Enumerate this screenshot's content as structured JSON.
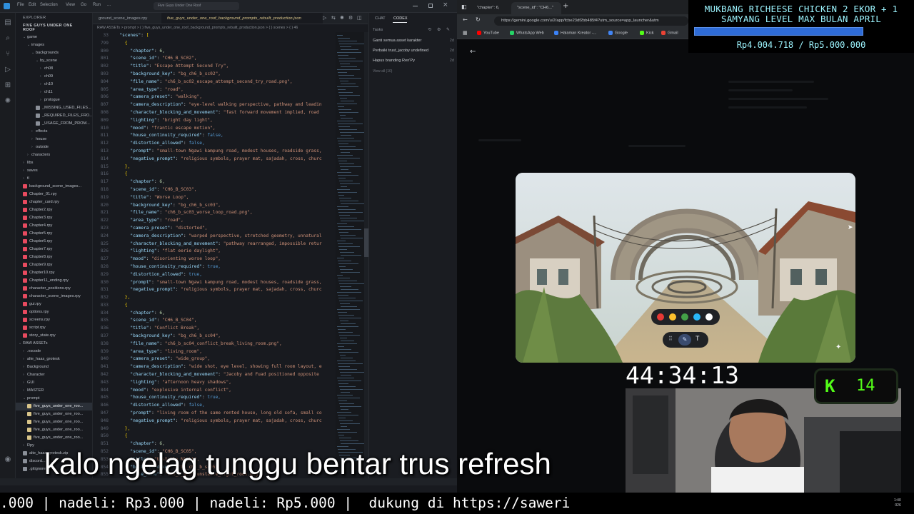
{
  "vscode": {
    "title": "Five Guys Under One Roof",
    "menu": [
      "File",
      "Edit",
      "Selection",
      "View",
      "Go",
      "Run",
      "..."
    ],
    "explorer_header": "EXPLORER",
    "project_name": "FIVE GUYS UNDER ONE ROOF",
    "tree": [
      {
        "label": "game",
        "indent": 1,
        "kind": "folder-open"
      },
      {
        "label": "images",
        "indent": 2,
        "kind": "folder-open"
      },
      {
        "label": "backgrounds",
        "indent": 3,
        "kind": "folder-open"
      },
      {
        "label": "by_scene",
        "indent": 4,
        "kind": "folder-open"
      },
      {
        "label": "ch08",
        "indent": 5,
        "kind": "folder"
      },
      {
        "label": "ch09",
        "indent": 5,
        "kind": "folder"
      },
      {
        "label": "ch10",
        "indent": 5,
        "kind": "folder"
      },
      {
        "label": "ch11",
        "indent": 5,
        "kind": "folder"
      },
      {
        "label": "prologue",
        "indent": 5,
        "kind": "folder"
      },
      {
        "label": "_MISSING_USED_FILES...",
        "indent": 4,
        "kind": "file"
      },
      {
        "label": "_REQUIRED_FILES_FRO...",
        "indent": 4,
        "kind": "file"
      },
      {
        "label": "_USAGE_FROM_PROM...",
        "indent": 4,
        "kind": "file"
      },
      {
        "label": "effects",
        "indent": 3,
        "kind": "folder"
      },
      {
        "label": "house",
        "indent": 3,
        "kind": "folder"
      },
      {
        "label": "outside",
        "indent": 3,
        "kind": "folder"
      },
      {
        "label": "characters",
        "indent": 2,
        "kind": "folder"
      },
      {
        "label": "libs",
        "indent": 1,
        "kind": "folder"
      },
      {
        "label": "saves",
        "indent": 1,
        "kind": "folder"
      },
      {
        "label": "tl",
        "indent": 1,
        "kind": "folder"
      },
      {
        "label": "background_scene_images...",
        "indent": 1,
        "kind": "rpy"
      },
      {
        "label": "Chapter_01.rpy",
        "indent": 1,
        "kind": "rpy"
      },
      {
        "label": "chapter_card.rpy",
        "indent": 1,
        "kind": "rpy"
      },
      {
        "label": "Chapter2.rpy",
        "indent": 1,
        "kind": "rpy"
      },
      {
        "label": "Chapter3.rpy",
        "indent": 1,
        "kind": "rpy"
      },
      {
        "label": "Chapter4.rpy",
        "indent": 1,
        "kind": "rpy"
      },
      {
        "label": "Chapter5.rpy",
        "indent": 1,
        "kind": "rpy"
      },
      {
        "label": "Chapter6.rpy",
        "indent": 1,
        "kind": "rpy"
      },
      {
        "label": "Chapter7.rpy",
        "indent": 1,
        "kind": "rpy"
      },
      {
        "label": "Chapter8.rpy",
        "indent": 1,
        "kind": "rpy"
      },
      {
        "label": "Chapter9.rpy",
        "indent": 1,
        "kind": "rpy"
      },
      {
        "label": "Chapter10.rpy",
        "indent": 1,
        "kind": "rpy"
      },
      {
        "label": "Chapter11_ending.rpy",
        "indent": 1,
        "kind": "rpy"
      },
      {
        "label": "character_positions.rpy",
        "indent": 1,
        "kind": "rpy"
      },
      {
        "label": "character_scene_images.rpy",
        "indent": 1,
        "kind": "rpy"
      },
      {
        "label": "gui.rpy",
        "indent": 1,
        "kind": "rpy"
      },
      {
        "label": "options.rpy",
        "indent": 1,
        "kind": "rpy"
      },
      {
        "label": "screens.rpy",
        "indent": 1,
        "kind": "rpy"
      },
      {
        "label": "script.rpy",
        "indent": 1,
        "kind": "rpy"
      },
      {
        "label": "story_state.rpy",
        "indent": 1,
        "kind": "rpy"
      },
      {
        "label": "RAW ASSETs",
        "indent": 0,
        "kind": "folder-open"
      },
      {
        "label": ".vscode",
        "indent": 1,
        "kind": "folder"
      },
      {
        "label": "alte_haas_grotesk",
        "indent": 1,
        "kind": "folder"
      },
      {
        "label": "Background",
        "indent": 1,
        "kind": "folder"
      },
      {
        "label": "Character",
        "indent": 1,
        "kind": "folder"
      },
      {
        "label": "GUI",
        "indent": 1,
        "kind": "folder"
      },
      {
        "label": "MASTER",
        "indent": 1,
        "kind": "folder"
      },
      {
        "label": "prompt",
        "indent": 1,
        "kind": "folder-open"
      },
      {
        "label": "five_guys_under_one_roo...",
        "indent": 2,
        "kind": "json",
        "selected": true
      },
      {
        "label": "five_guys_under_one_roo...",
        "indent": 2,
        "kind": "json"
      },
      {
        "label": "five_guys_under_one_roo...",
        "indent": 2,
        "kind": "json"
      },
      {
        "label": "five_guys_under_one_roo...",
        "indent": 2,
        "kind": "json"
      },
      {
        "label": "five_guys_under_one_roo...",
        "indent": 2,
        "kind": "json"
      },
      {
        "label": "Rpy",
        "indent": 1,
        "kind": "folder"
      },
      {
        "label": "alte_haas_grotesk.zip",
        "indent": 1,
        "kind": "file"
      },
      {
        "label": "discord...",
        "indent": 1,
        "kind": "file"
      },
      {
        "label": ".gitignore",
        "indent": 1,
        "kind": "file"
      }
    ],
    "tabs": [
      "ground_scene_images.rpy",
      "five_guys_under_one_roof_background_prompts_rebuilt_production.json"
    ],
    "breadcrumb": "RAW ASSETs > prompt > { } five_guys_under_one_roof_background_prompts_rebuilt_production.json > { } scenes > { } 46",
    "code_lines": [
      {
        "n": "33",
        "t": "  \"scenes\": ["
      },
      {
        "n": "799",
        "t": "    {"
      },
      {
        "n": "800",
        "t": "      \"chapter\": 6,"
      },
      {
        "n": "801",
        "t": "      \"scene_id\": \"CH6_B_SC02\","
      },
      {
        "n": "802",
        "t": "      \"title\": \"Escape Attempt Second Try\","
      },
      {
        "n": "803",
        "t": "      \"background_key\": \"bg_ch6_b_sc02\","
      },
      {
        "n": "804",
        "t": "      \"file_name\": \"ch6_b_sc02_escape_attempt_second_try_road.png\","
      },
      {
        "n": "805",
        "t": "      \"area_type\": \"road\","
      },
      {
        "n": "806",
        "t": "      \"camera_preset\": \"walking\","
      },
      {
        "n": "807",
        "t": "      \"camera_description\": \"eye-level walking perspective, pathway and leadin"
      },
      {
        "n": "808",
        "t": "      \"character_blocking_and_movement\": \"fast forward movement implied, road"
      },
      {
        "n": "809",
        "t": "      \"lighting\": \"bright day light\","
      },
      {
        "n": "810",
        "t": "      \"mood\": \"frantic escape motion\","
      },
      {
        "n": "811",
        "t": "      \"house_continuity_required\": false,"
      },
      {
        "n": "812",
        "t": "      \"distortion_allowed\": false,"
      },
      {
        "n": "813",
        "t": "      \"prompt\": \"small-town Ngawi kampung road, modest houses, roadside grass,"
      },
      {
        "n": "814",
        "t": "      \"negative_prompt\": \"religious symbols, prayer mat, sajadah, cross, churc"
      },
      {
        "n": "815",
        "t": "    },"
      },
      {
        "n": "816",
        "t": "    {"
      },
      {
        "n": "817",
        "t": "      \"chapter\": 6,"
      },
      {
        "n": "818",
        "t": "      \"scene_id\": \"CH6_B_SC03\","
      },
      {
        "n": "819",
        "t": "      \"title\": \"Worse Loop\","
      },
      {
        "n": "820",
        "t": "      \"background_key\": \"bg_ch6_b_sc03\","
      },
      {
        "n": "821",
        "t": "      \"file_name\": \"ch6_b_sc03_worse_loop_road.png\","
      },
      {
        "n": "822",
        "t": "      \"area_type\": \"road\","
      },
      {
        "n": "823",
        "t": "      \"camera_preset\": \"distorted\","
      },
      {
        "n": "824",
        "t": "      \"camera_description\": \"warped perspective, stretched geometry, unnatural"
      },
      {
        "n": "825",
        "t": "      \"character_blocking_and_movement\": \"pathway rearranged, impossible retur"
      },
      {
        "n": "826",
        "t": "      \"lighting\": \"flat eerie daylight\","
      },
      {
        "n": "827",
        "t": "      \"mood\": \"disorienting worse loop\","
      },
      {
        "n": "828",
        "t": "      \"house_continuity_required\": true,"
      },
      {
        "n": "829",
        "t": "      \"distortion_allowed\": true,"
      },
      {
        "n": "830",
        "t": "      \"prompt\": \"small-town Ngawi kampung road, modest houses, roadside grass,"
      },
      {
        "n": "831",
        "t": "      \"negative_prompt\": \"religious symbols, prayer mat, sajadah, cross, churc"
      },
      {
        "n": "832",
        "t": "    },"
      },
      {
        "n": "833",
        "t": "    {"
      },
      {
        "n": "834",
        "t": "      \"chapter\": 6,"
      },
      {
        "n": "835",
        "t": "      \"scene_id\": \"CH6_B_SC04\","
      },
      {
        "n": "836",
        "t": "      \"title\": \"Conflict Break\","
      },
      {
        "n": "837",
        "t": "      \"background_key\": \"bg_ch6_b_sc04\","
      },
      {
        "n": "838",
        "t": "      \"file_name\": \"ch6_b_sc04_conflict_break_living_room.png\","
      },
      {
        "n": "839",
        "t": "      \"area_type\": \"living_room\","
      },
      {
        "n": "840",
        "t": "      \"camera_preset\": \"wide_group\","
      },
      {
        "n": "841",
        "t": "      \"camera_description\": \"wide shot, eye level, showing full room layout, e"
      },
      {
        "n": "842",
        "t": "      \"character_blocking_and_movement\": \"Jacoby and Fuad positioned opposite"
      },
      {
        "n": "843",
        "t": "      \"lighting\": \"afternoon heavy shadows\","
      },
      {
        "n": "844",
        "t": "      \"mood\": \"explosive internal conflict\","
      },
      {
        "n": "845",
        "t": "      \"house_continuity_required\": true,"
      },
      {
        "n": "846",
        "t": "      \"distortion_allowed\": false,"
      },
      {
        "n": "847",
        "t": "      \"prompt\": \"living room of the same rented house, long old sofa, small co"
      },
      {
        "n": "848",
        "t": "      \"negative_prompt\": \"religious symbols, prayer mat, sajadah, cross, churc"
      },
      {
        "n": "849",
        "t": "    },"
      },
      {
        "n": "850",
        "t": "    {"
      },
      {
        "n": "851",
        "t": "      \"chapter\": 6,"
      },
      {
        "n": "852",
        "t": "      \"scene_id\": \"CH6_B_SC05\","
      },
      {
        "n": "853",
        "t": "      \"title\": \"Unstable Night\","
      },
      {
        "n": "854",
        "t": "      \"background_key\": \"bg_ch6_b_sc05\","
      },
      {
        "n": "855",
        "t": "      \"file_name\": \"ch6_b_sc05_unstable_night_room.png\","
      },
      {
        "n": "856",
        "t": "      \"area_type\": \"room\","
      },
      {
        "n": "857",
        "t": "      \"camera_preset\": \"tight_tension\","
      },
      {
        "n": "858",
        "t": "      \"camera_description\": \"tight close perspective, slightly zoomed, cinemat"
      },
      {
        "n": "859",
        "t": "      \"character_blocking_and_movement\": \"MC alone, camera slightly tilted, an"
      },
      {
        "n": "860",
        "t": "      \"lighting\": \"dark night light\","
      }
    ],
    "chat": {
      "tabs": [
        "CHAT",
        "CODEX"
      ],
      "tasks_label": "Tasks",
      "tasks": [
        {
          "label": "Ganti semua asset karakter",
          "age": "2d"
        },
        {
          "label": "Perbaiki trust_jacoby undefined",
          "age": "2d"
        },
        {
          "label": "Hapus branding Ren'Py",
          "age": "2d"
        }
      ],
      "view_all": "View all (10)"
    }
  },
  "browser": {
    "tabs": [
      "\"chapter\": 6,",
      "\"scene_id\": \"CH6...\""
    ],
    "url": "https://gemini.google.com/u/2/app/fcbe23df2bb485f4?utm_source=app_launcher&utm",
    "bookmarks": [
      {
        "label": "YouTube",
        "color": "#ff0000"
      },
      {
        "label": "WhatsApp Web",
        "color": "#25d366"
      },
      {
        "label": "Halaman Kreator -...",
        "color": "#3b82f6"
      },
      {
        "label": "Google",
        "color": "#4285f4"
      },
      {
        "label": "Kick",
        "color": "#53fc18"
      },
      {
        "label": "Gmail",
        "color": "#ea4335"
      }
    ],
    "toolbar_colors": [
      "#e53935",
      "#fbc02d",
      "#43a047",
      "#29b6f6",
      "#ffffff"
    ],
    "tool_icons": [
      "grip-icon",
      "pen-icon",
      "text-icon"
    ],
    "tool_text": "T"
  },
  "overlay": {
    "goal_title_line1": "MUKBANG RICHEESE CHICKEN 2 EKOR + 1",
    "goal_title_line2": "SAMYANG LEVEL MAX BULAN APRIL",
    "goal_amount": "Rp4.004.718 / Rp5.000.000",
    "goal_progress": 0.801,
    "timer": "44:34:13",
    "kick_count": "14",
    "subtitle": "kalo ngelag tunggu bentar trus refresh",
    "ticker": ".000 | nadeli: Rp3.000 | nadeli: Rp5.000 |  dukung di https://saweri",
    "systray_time": "1:40",
    "systray_date": "026"
  }
}
